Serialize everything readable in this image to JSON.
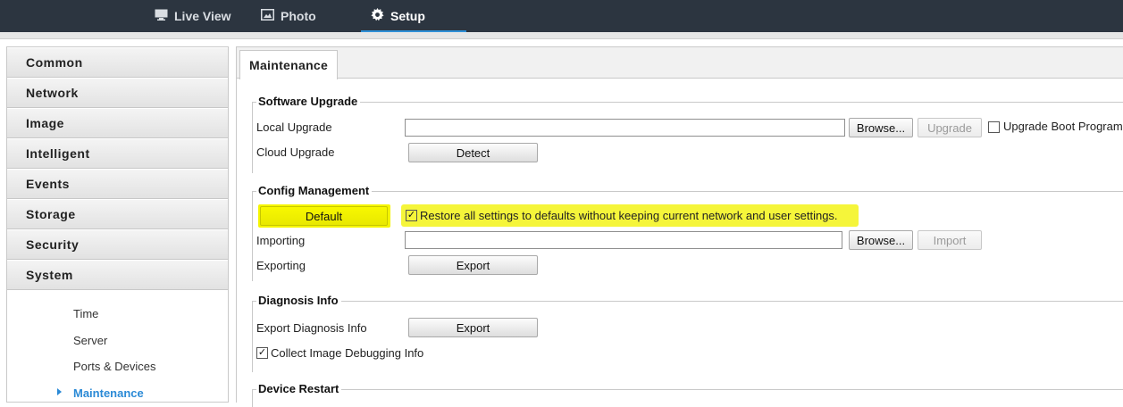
{
  "nav": {
    "tabs": [
      {
        "label": "Live View",
        "icon": "monitor-icon"
      },
      {
        "label": "Photo",
        "icon": "photo-icon"
      },
      {
        "label": "Setup",
        "icon": "gear-icon"
      }
    ],
    "active": "Setup"
  },
  "sidebar": {
    "items": [
      "Common",
      "Network",
      "Image",
      "Intelligent",
      "Events",
      "Storage",
      "Security",
      "System"
    ],
    "sub_items": [
      "Time",
      "Server",
      "Ports & Devices",
      "Maintenance"
    ],
    "active_sub": "Maintenance"
  },
  "main": {
    "tab": "Maintenance",
    "software_upgrade": {
      "legend": "Software Upgrade",
      "local_upgrade_label": "Local Upgrade",
      "local_upgrade_value": "",
      "browse": "Browse...",
      "upgrade": "Upgrade",
      "boot_checkbox": "Upgrade Boot Program",
      "boot_checked": false,
      "cloud_upgrade_label": "Cloud Upgrade",
      "detect": "Detect"
    },
    "config_management": {
      "legend": "Config Management",
      "default": "Default",
      "restore_text": "Restore all settings to defaults without keeping current network and user settings.",
      "restore_checked": true,
      "importing_label": "Importing",
      "importing_value": "",
      "browse": "Browse...",
      "import": "Import",
      "exporting_label": "Exporting",
      "export": "Export"
    },
    "diagnosis_info": {
      "legend": "Diagnosis Info",
      "export_label": "Export Diagnosis Info",
      "export": "Export",
      "collect_text": "Collect Image Debugging Info",
      "collect_checked": true
    },
    "device_restart": {
      "legend": "Device Restart"
    }
  },
  "colors": {
    "topbar": "#2c3540",
    "accent": "#2b8ad6",
    "highlight": "#f5f500"
  }
}
